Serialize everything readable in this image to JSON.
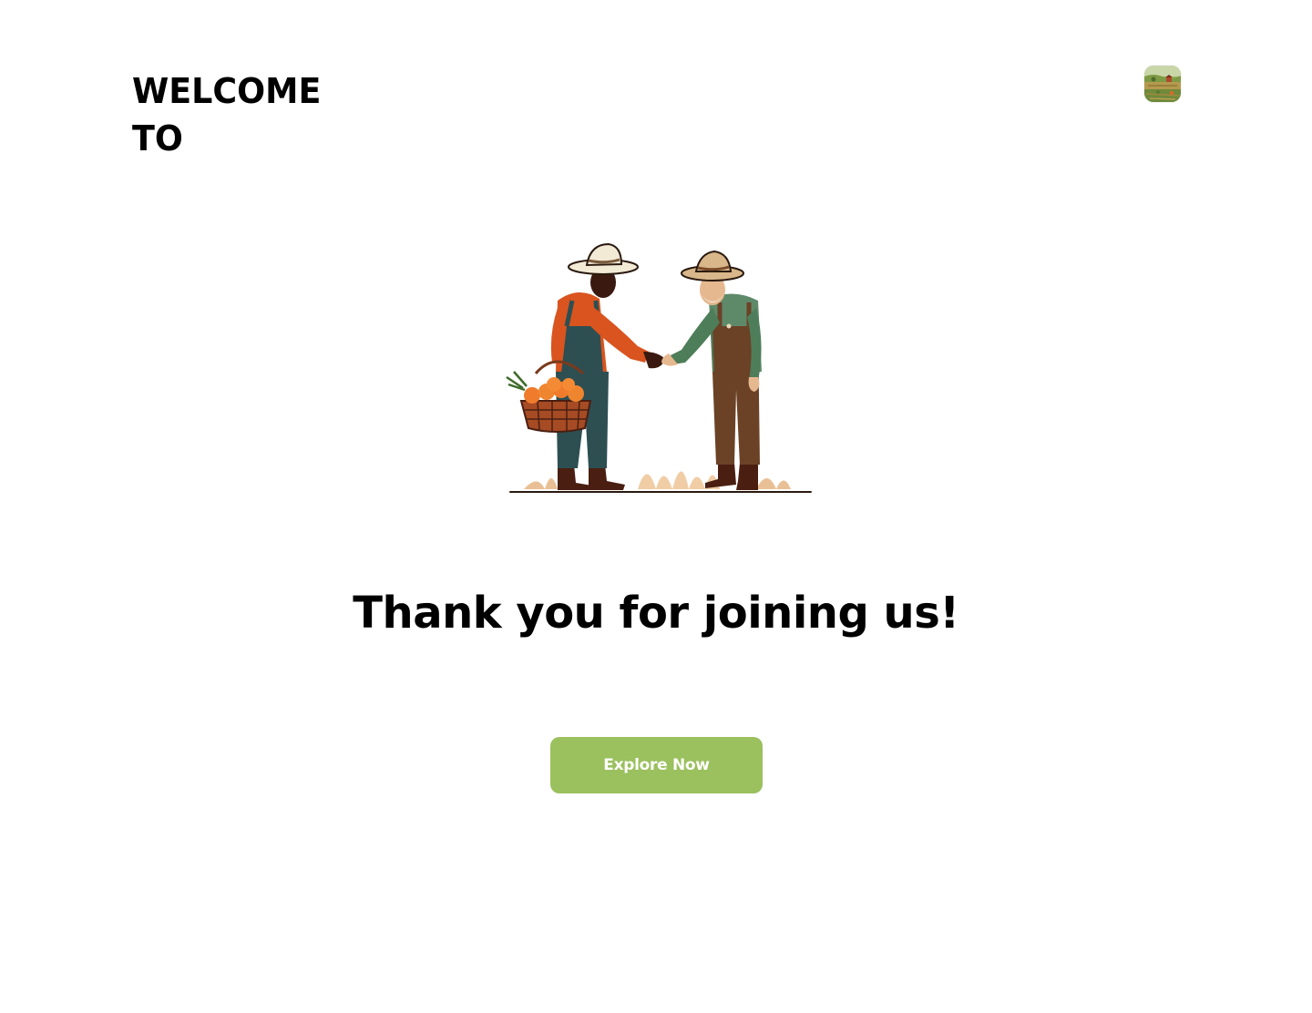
{
  "header": {
    "welcome_text": "WELCOME TO",
    "avatar_icon": "farm-landscape-avatar-icon"
  },
  "hero": {
    "illustration": "farmers-handshake-illustration"
  },
  "main": {
    "headline": "Thank you for joining us!",
    "cta_label": "Explore Now"
  },
  "colors": {
    "background": "#ffffff",
    "text": "#000000",
    "cta_background": "#9bc05e",
    "cta_text": "#ffffff"
  }
}
